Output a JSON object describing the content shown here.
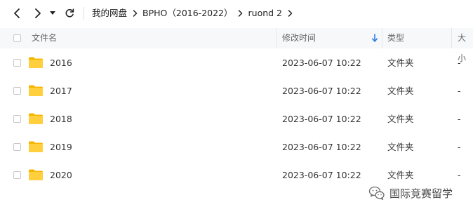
{
  "nav": {
    "back_icon": "chevron-left-icon",
    "forward_icon": "chevron-right-icon",
    "history_icon": "caret-down-icon",
    "refresh_icon": "refresh-icon"
  },
  "breadcrumb": [
    {
      "label": "我的网盘"
    },
    {
      "label": "BPHO（2016-2022）"
    },
    {
      "label": "ruond 2"
    }
  ],
  "table": {
    "columns": {
      "name": "文件名",
      "modified": "修改时间",
      "type": "类型",
      "size": "大小"
    },
    "sort": {
      "column": "modified",
      "direction": "descending"
    },
    "rows": [
      {
        "name": "2016",
        "modified": "2023-06-07 10:22",
        "type": "文件夹",
        "size": "-"
      },
      {
        "name": "2017",
        "modified": "2023-06-07 10:22",
        "type": "文件夹",
        "size": "-"
      },
      {
        "name": "2018",
        "modified": "2023-06-07 10:22",
        "type": "文件夹",
        "size": "-"
      },
      {
        "name": "2019",
        "modified": "2023-06-07 10:22",
        "type": "文件夹",
        "size": "-"
      },
      {
        "name": "2020",
        "modified": "2023-06-07 10:22",
        "type": "文件夹",
        "size": "-"
      }
    ]
  },
  "watermark": {
    "text": "国际竞赛留学",
    "icon": "wechat-icon"
  },
  "colors": {
    "folder": "#ffc933",
    "sort_arrow": "#2f7de1",
    "header_bg": "#f7f8fa"
  }
}
